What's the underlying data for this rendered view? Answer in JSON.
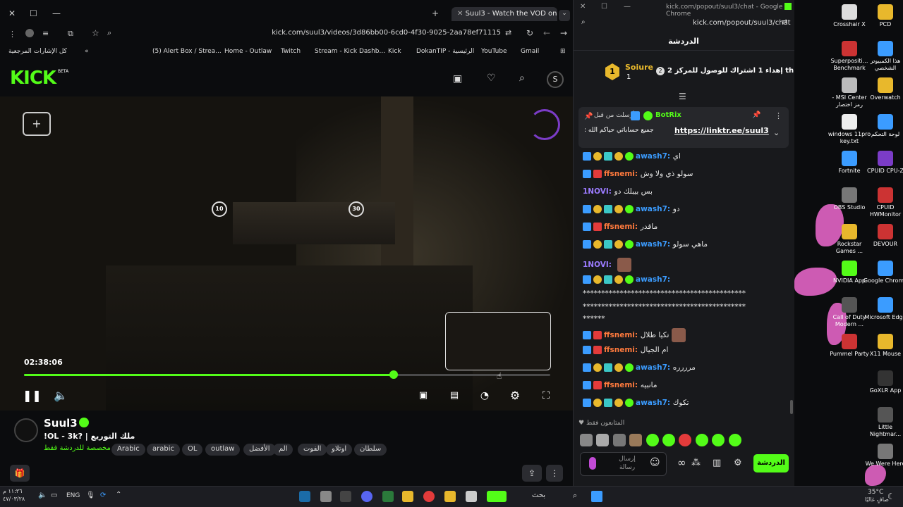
{
  "browser": {
    "tab_title": "Suul3 - Watch the VOD on",
    "url": "kick.com/suul3/videos/3d86bb00-6cd0-4f30-9025-2aa78ef71115",
    "bookmarks": [
      "كل الإشارات المرجعية",
      "(5) Alert Box / Strea...",
      "Home - Outlaw",
      "Twitch",
      "Stream - Kick Dashb...",
      "Kick",
      "DokanTIP - الرئيسية",
      "YouTube",
      "Gmail"
    ]
  },
  "kick": {
    "logo": "KICK",
    "beta": "BETA"
  },
  "player": {
    "timecode": "02:38:06",
    "progress": 0.702,
    "rewind_label": "10",
    "forward_label": "30"
  },
  "stream": {
    "channel_name": "Suul3",
    "title": "!OL - 3k? | ملك التوريع",
    "category": "مخصصة للدردشة فقط",
    "tags": [
      "Arabic",
      "arabic",
      "OL",
      "outlaw",
      "الأفضل",
      "الم",
      "الفوت",
      "اوتلاو",
      "سلطان"
    ]
  },
  "chat": {
    "window_title": "kick.com/popout/suul3/chat - Google Chrome",
    "url": "kick.com/popout/suul3/chat",
    "header": "الدردشة",
    "goal_user": "Soiure",
    "goal_count": "1",
    "goal_text": "إهداء 1 اشتراك للوصول للمركز 2 th",
    "goal_rank": "2",
    "pinned_by": "أرسلت من قبل",
    "pinned_user": "BotRix",
    "pinned_text": ": جميع حساباتي حياكم الله",
    "pinned_link": "https://linktr.ee/suul3",
    "messages": [
      {
        "user": "awash7",
        "text": "اي",
        "color": "#3b9cff"
      },
      {
        "user": "ffsnemi",
        "text": "سولو ذي ولا وش",
        "color": "#ff7a3d"
      },
      {
        "user": "1NOVI",
        "text": "بس بيبلك دو",
        "color": "#9b7bff"
      },
      {
        "user": "awash7",
        "text": "دو",
        "color": "#3b9cff"
      },
      {
        "user": "ffsnemi",
        "text": "ماقدر",
        "color": "#ff7a3d"
      },
      {
        "user": "awash7",
        "text": "ماهي سولو",
        "color": "#3b9cff"
      },
      {
        "user": "1NOVI",
        "text": "",
        "color": "#9b7bff"
      },
      {
        "user": "awash7",
        "text": "",
        "color": "#3b9cff"
      },
      {
        "user": "ffsnemi",
        "text": "تكيا طلال",
        "color": "#ff7a3d"
      },
      {
        "user": "ffsnemi",
        "text": "ام الجيال",
        "color": "#ff7a3d"
      },
      {
        "user": "awash7",
        "text": "مرررره",
        "color": "#3b9cff"
      },
      {
        "user": "ffsnemi",
        "text": "مانبيه",
        "color": "#ff7a3d"
      },
      {
        "user": "awash7",
        "text": "تكوك",
        "color": "#3b9cff"
      }
    ],
    "spam_line_1": "********************************************",
    "spam_line_2": "********************************************",
    "spam_line_3": "******",
    "followers_only": "المتابعون فقط",
    "input_placeholder": "إرسال رسالة",
    "send_label": "الدردشة"
  },
  "desktop": {
    "icons": [
      "Crosshair X",
      "PCD",
      "Superpositi... Benchmark",
      "هذا الكمبيوتر الشخصي",
      "- MSI Center رمز اختصار",
      "Overwatch",
      "windows 11pro key.txt",
      "لوحة التحكم",
      "Fortnite",
      "CPUID CPU-Z",
      "OBS Studio",
      "CPUID HWMonitor",
      "Rockstar Games ...",
      "DEVOUR",
      "NVIDIA App",
      "Google Chrome",
      "Call of Duty Modern ...",
      "Microsoft Edge",
      "Pummel Party",
      "X11 Mouse",
      "GoXLR App",
      "Little Nightmar...",
      "We Were Here"
    ]
  },
  "taskbar": {
    "time": "١١:٣٦ م",
    "date": "٤٧/٠٣/٢٨",
    "lang": "ENG",
    "search": "بحث",
    "weather_temp": "35°C",
    "weather_text": "صافٍ غالبًا"
  }
}
